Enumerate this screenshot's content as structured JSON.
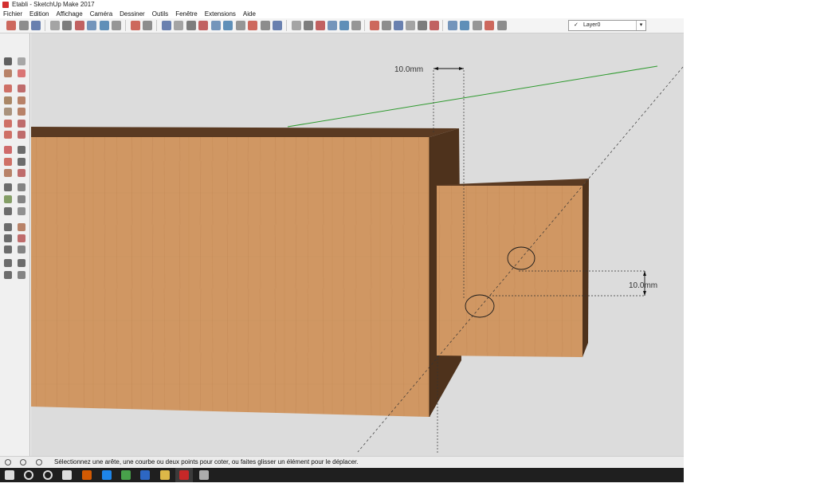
{
  "window": {
    "title": "Etabli - SketchUp Make 2017"
  },
  "menu": {
    "items": [
      "Fichier",
      "Edition",
      "Affichage",
      "Caméra",
      "Dessiner",
      "Outils",
      "Fenêtre",
      "Extensions",
      "Aide"
    ]
  },
  "toolbar": {
    "icons": [
      "get-started-icon",
      "open-icon",
      "save-icon",
      "cut-icon",
      "copy-icon",
      "paste-icon",
      "erase-icon",
      "undo-icon",
      "redo-icon",
      "print-icon",
      "model-info-icon",
      "shape-icon",
      "line-icon",
      "grid-icon",
      "arc-icon",
      "tag-icon",
      "push-icon",
      "follow-icon",
      "fill-icon",
      "swap-icon",
      "stack-icon",
      "iso-view-icon",
      "top-view-icon",
      "front-view-icon",
      "right-view-icon",
      "back-view-icon",
      "left-view-icon",
      "xray-icon",
      "wireframe-icon",
      "hidden-line-icon",
      "shaded-icon",
      "shaded-textures-icon",
      "monochrome-icon",
      "warehouse-icon",
      "extension-warehouse-icon",
      "share-icon",
      "layout-icon",
      "components-icon"
    ],
    "layer": {
      "check": "✓",
      "selected": "Layer0"
    }
  },
  "left_tools": {
    "icons": [
      "select-icon",
      "make-component-icon",
      "paint-bucket-icon",
      "eraser-icon",
      "pencil-icon",
      "freehand-icon",
      "rectangle-icon",
      "rotated-rectangle-icon",
      "circle-icon",
      "polygon-icon",
      "arc-icon",
      "pie-icon",
      "3pt-arc-icon",
      "2pt-arc-icon",
      "move-icon",
      "push-pull-icon",
      "rotate-icon",
      "follow-me-icon",
      "scale-icon",
      "offset-icon",
      "tape-measure-icon",
      "dimension-icon",
      "protractor-icon",
      "text-icon",
      "axes-icon",
      "3d-text-icon",
      "orbit-icon",
      "pan-icon",
      "zoom-icon",
      "zoom-window-icon",
      "zoom-extents-icon",
      "previous-icon",
      "position-camera-icon",
      "look-around-icon",
      "walk-icon",
      "section-plane-icon"
    ]
  },
  "viewport": {
    "dimension_top": "10.0mm",
    "dimension_right": "10.0mm"
  },
  "status": {
    "text": "Sélectionnez une arête, une courbe ou deux points pour coter, ou faites glisser un élément pour le déplacer."
  },
  "taskbar": {
    "icons": [
      "windows-start-icon",
      "search-icon",
      "cortana-icon",
      "task-view-icon",
      "firefox-icon",
      "edge-icon",
      "chrome-icon",
      "store-icon",
      "file-explorer-icon",
      "sketchup-icon",
      "other-app-icon"
    ]
  },
  "colors": {
    "wood_light": "#cf9560",
    "wood_dark": "#5a3a22",
    "axis_green": "#2e9a2e",
    "viewport_bg": "#dcdcdc"
  }
}
